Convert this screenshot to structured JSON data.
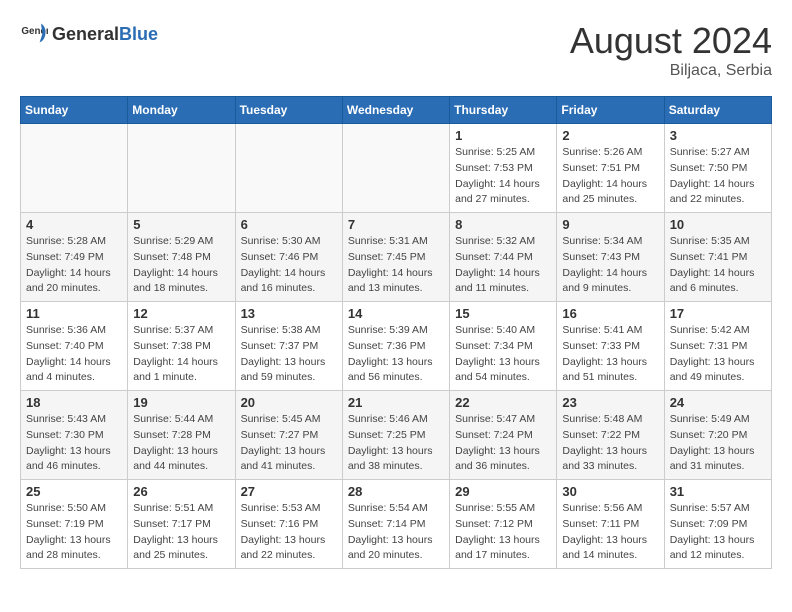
{
  "header": {
    "logo_general": "General",
    "logo_blue": "Blue",
    "month_year": "August 2024",
    "location": "Biljaca, Serbia"
  },
  "calendar": {
    "days_of_week": [
      "Sunday",
      "Monday",
      "Tuesday",
      "Wednesday",
      "Thursday",
      "Friday",
      "Saturday"
    ],
    "weeks": [
      [
        {
          "day": "",
          "detail": ""
        },
        {
          "day": "",
          "detail": ""
        },
        {
          "day": "",
          "detail": ""
        },
        {
          "day": "",
          "detail": ""
        },
        {
          "day": "1",
          "detail": "Sunrise: 5:25 AM\nSunset: 7:53 PM\nDaylight: 14 hours\nand 27 minutes."
        },
        {
          "day": "2",
          "detail": "Sunrise: 5:26 AM\nSunset: 7:51 PM\nDaylight: 14 hours\nand 25 minutes."
        },
        {
          "day": "3",
          "detail": "Sunrise: 5:27 AM\nSunset: 7:50 PM\nDaylight: 14 hours\nand 22 minutes."
        }
      ],
      [
        {
          "day": "4",
          "detail": "Sunrise: 5:28 AM\nSunset: 7:49 PM\nDaylight: 14 hours\nand 20 minutes."
        },
        {
          "day": "5",
          "detail": "Sunrise: 5:29 AM\nSunset: 7:48 PM\nDaylight: 14 hours\nand 18 minutes."
        },
        {
          "day": "6",
          "detail": "Sunrise: 5:30 AM\nSunset: 7:46 PM\nDaylight: 14 hours\nand 16 minutes."
        },
        {
          "day": "7",
          "detail": "Sunrise: 5:31 AM\nSunset: 7:45 PM\nDaylight: 14 hours\nand 13 minutes."
        },
        {
          "day": "8",
          "detail": "Sunrise: 5:32 AM\nSunset: 7:44 PM\nDaylight: 14 hours\nand 11 minutes."
        },
        {
          "day": "9",
          "detail": "Sunrise: 5:34 AM\nSunset: 7:43 PM\nDaylight: 14 hours\nand 9 minutes."
        },
        {
          "day": "10",
          "detail": "Sunrise: 5:35 AM\nSunset: 7:41 PM\nDaylight: 14 hours\nand 6 minutes."
        }
      ],
      [
        {
          "day": "11",
          "detail": "Sunrise: 5:36 AM\nSunset: 7:40 PM\nDaylight: 14 hours\nand 4 minutes."
        },
        {
          "day": "12",
          "detail": "Sunrise: 5:37 AM\nSunset: 7:38 PM\nDaylight: 14 hours\nand 1 minute."
        },
        {
          "day": "13",
          "detail": "Sunrise: 5:38 AM\nSunset: 7:37 PM\nDaylight: 13 hours\nand 59 minutes."
        },
        {
          "day": "14",
          "detail": "Sunrise: 5:39 AM\nSunset: 7:36 PM\nDaylight: 13 hours\nand 56 minutes."
        },
        {
          "day": "15",
          "detail": "Sunrise: 5:40 AM\nSunset: 7:34 PM\nDaylight: 13 hours\nand 54 minutes."
        },
        {
          "day": "16",
          "detail": "Sunrise: 5:41 AM\nSunset: 7:33 PM\nDaylight: 13 hours\nand 51 minutes."
        },
        {
          "day": "17",
          "detail": "Sunrise: 5:42 AM\nSunset: 7:31 PM\nDaylight: 13 hours\nand 49 minutes."
        }
      ],
      [
        {
          "day": "18",
          "detail": "Sunrise: 5:43 AM\nSunset: 7:30 PM\nDaylight: 13 hours\nand 46 minutes."
        },
        {
          "day": "19",
          "detail": "Sunrise: 5:44 AM\nSunset: 7:28 PM\nDaylight: 13 hours\nand 44 minutes."
        },
        {
          "day": "20",
          "detail": "Sunrise: 5:45 AM\nSunset: 7:27 PM\nDaylight: 13 hours\nand 41 minutes."
        },
        {
          "day": "21",
          "detail": "Sunrise: 5:46 AM\nSunset: 7:25 PM\nDaylight: 13 hours\nand 38 minutes."
        },
        {
          "day": "22",
          "detail": "Sunrise: 5:47 AM\nSunset: 7:24 PM\nDaylight: 13 hours\nand 36 minutes."
        },
        {
          "day": "23",
          "detail": "Sunrise: 5:48 AM\nSunset: 7:22 PM\nDaylight: 13 hours\nand 33 minutes."
        },
        {
          "day": "24",
          "detail": "Sunrise: 5:49 AM\nSunset: 7:20 PM\nDaylight: 13 hours\nand 31 minutes."
        }
      ],
      [
        {
          "day": "25",
          "detail": "Sunrise: 5:50 AM\nSunset: 7:19 PM\nDaylight: 13 hours\nand 28 minutes."
        },
        {
          "day": "26",
          "detail": "Sunrise: 5:51 AM\nSunset: 7:17 PM\nDaylight: 13 hours\nand 25 minutes."
        },
        {
          "day": "27",
          "detail": "Sunrise: 5:53 AM\nSunset: 7:16 PM\nDaylight: 13 hours\nand 22 minutes."
        },
        {
          "day": "28",
          "detail": "Sunrise: 5:54 AM\nSunset: 7:14 PM\nDaylight: 13 hours\nand 20 minutes."
        },
        {
          "day": "29",
          "detail": "Sunrise: 5:55 AM\nSunset: 7:12 PM\nDaylight: 13 hours\nand 17 minutes."
        },
        {
          "day": "30",
          "detail": "Sunrise: 5:56 AM\nSunset: 7:11 PM\nDaylight: 13 hours\nand 14 minutes."
        },
        {
          "day": "31",
          "detail": "Sunrise: 5:57 AM\nSunset: 7:09 PM\nDaylight: 13 hours\nand 12 minutes."
        }
      ]
    ]
  }
}
